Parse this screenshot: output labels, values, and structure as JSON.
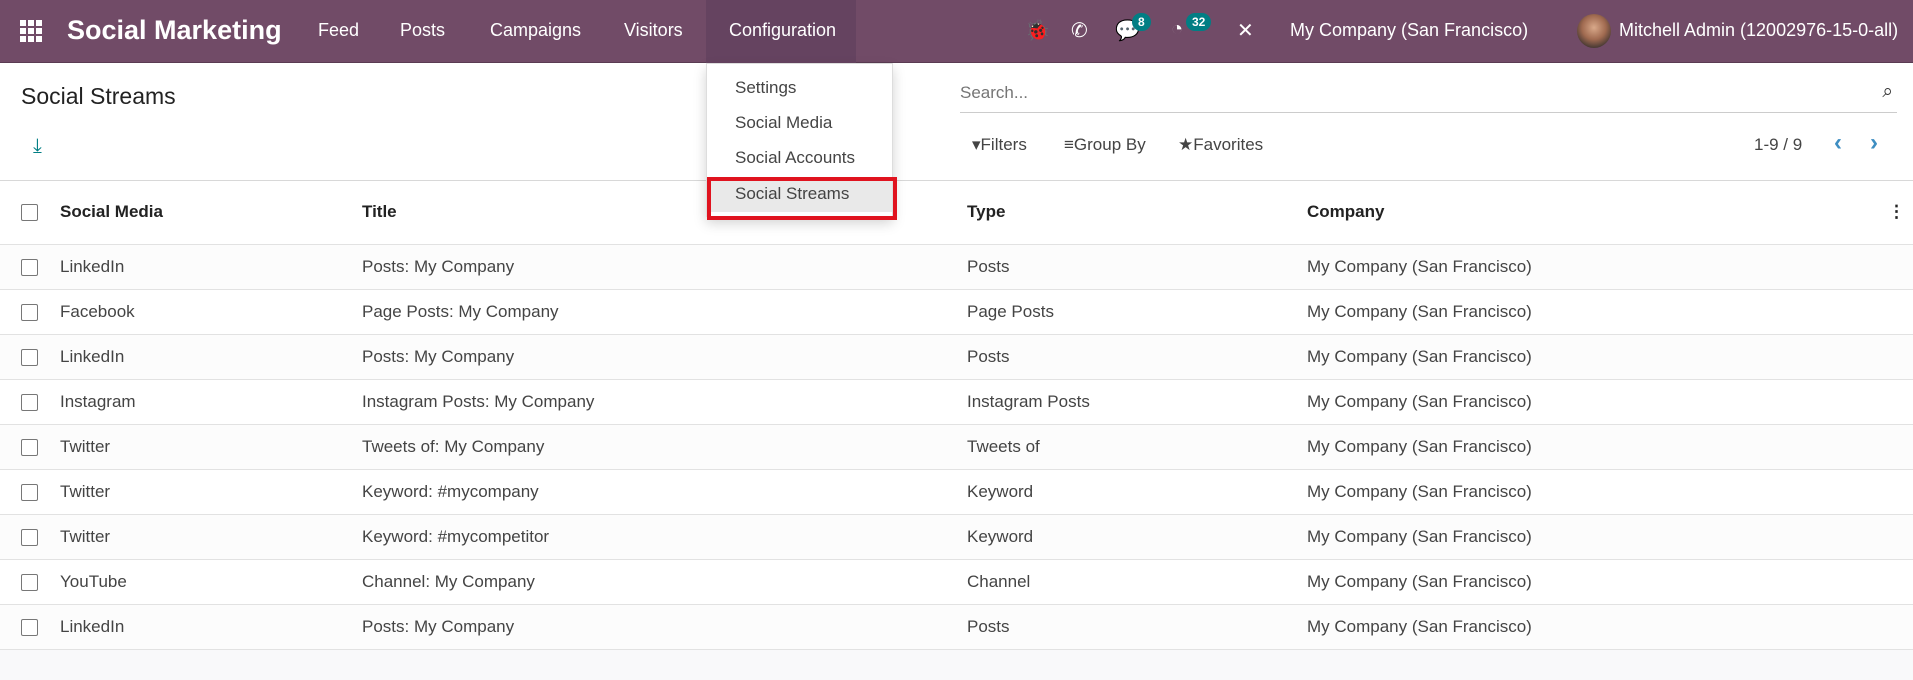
{
  "navbar": {
    "brand": "Social Marketing",
    "menu": [
      "Feed",
      "Posts",
      "Campaigns",
      "Visitors",
      "Configuration"
    ],
    "messages_count": "8",
    "activities_count": "32",
    "company": "My Company (San Francisco)",
    "user": "Mitchell Admin (12002976-15-0-all)"
  },
  "page": {
    "title": "Social Streams",
    "search_placeholder": "Search...",
    "filters": "Filters",
    "group_by": "Group By",
    "favorites": "Favorites",
    "pager": "1-9 / 9"
  },
  "dropdown": {
    "items": [
      "Settings",
      "Social Media",
      "Social Accounts",
      "Social Streams"
    ]
  },
  "table": {
    "headers": [
      "Social Media",
      "Title",
      "Type",
      "Company"
    ],
    "rows": [
      [
        "LinkedIn",
        "Posts: My Company",
        "Posts",
        "My Company (San Francisco)"
      ],
      [
        "Facebook",
        "Page Posts: My Company",
        "Page Posts",
        "My Company (San Francisco)"
      ],
      [
        "LinkedIn",
        "Posts: My Company",
        "Posts",
        "My Company (San Francisco)"
      ],
      [
        "Instagram",
        "Instagram Posts: My Company",
        "Instagram Posts",
        "My Company (San Francisco)"
      ],
      [
        "Twitter",
        "Tweets of: My Company",
        "Tweets of",
        "My Company (San Francisco)"
      ],
      [
        "Twitter",
        "Keyword: #mycompany",
        "Keyword",
        "My Company (San Francisco)"
      ],
      [
        "Twitter",
        "Keyword: #mycompetitor",
        "Keyword",
        "My Company (San Francisco)"
      ],
      [
        "YouTube",
        "Channel: My Company",
        "Channel",
        "My Company (San Francisco)"
      ],
      [
        "LinkedIn",
        "Posts: My Company",
        "Posts",
        "My Company (San Francisco)"
      ]
    ]
  },
  "colors": {
    "navbar": "#714b67",
    "accent": "#017e84",
    "highlight": "#e0131f"
  }
}
